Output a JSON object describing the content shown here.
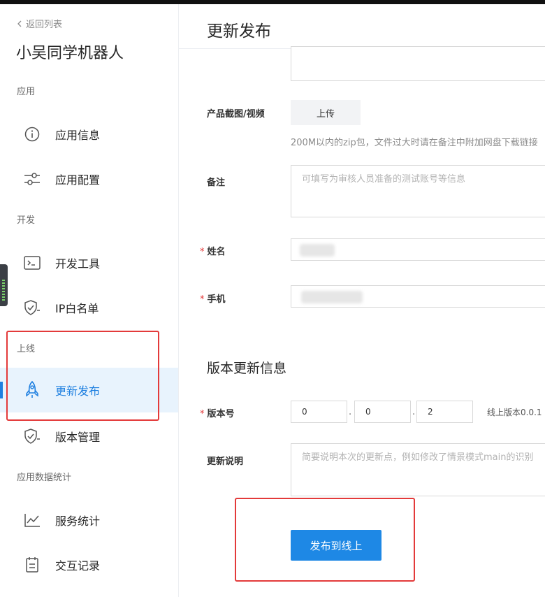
{
  "sidebar": {
    "back_label": "返回列表",
    "app_name": "小吴同学机器人",
    "groups": [
      {
        "label": "应用"
      },
      {
        "label": "开发"
      },
      {
        "label": "上线"
      },
      {
        "label": "应用数据统计"
      }
    ],
    "items": [
      {
        "label": "应用信息",
        "icon": "info-icon"
      },
      {
        "label": "应用配置",
        "icon": "sliders-icon"
      },
      {
        "label": "开发工具",
        "icon": "terminal-icon"
      },
      {
        "label": "IP白名单",
        "icon": "shield-icon"
      },
      {
        "label": "更新发布",
        "icon": "rocket-icon",
        "active": true
      },
      {
        "label": "版本管理",
        "icon": "shield-icon"
      },
      {
        "label": "服务统计",
        "icon": "line-chart-icon"
      },
      {
        "label": "交互记录",
        "icon": "calendar-list-icon"
      }
    ]
  },
  "main": {
    "title": "更新发布",
    "form": {
      "screenshot_label": "产品截图/视频",
      "upload_label": "上传",
      "upload_hint": "200M以内的zip包，文件过大时请在备注中附加网盘下载链接",
      "remark_label": "备注",
      "remark_placeholder": "可填写为审核人员准备的测试账号等信息",
      "name_label": "姓名",
      "phone_label": "手机",
      "required_mark": "*"
    },
    "version_section": {
      "title": "版本更新信息",
      "version_label": "版本号",
      "major": "0",
      "minor": "0",
      "patch": "2",
      "separator": ".",
      "online_version": "线上版本0.0.1",
      "notes_label": "更新说明",
      "notes_placeholder": "简要说明本次的更新点，例如修改了情景模式main的识别"
    },
    "publish_label": "发布到线上"
  },
  "colors": {
    "accent": "#1e88e5",
    "active_bg": "#e8f3fd",
    "highlight_red": "#e33a3a"
  }
}
